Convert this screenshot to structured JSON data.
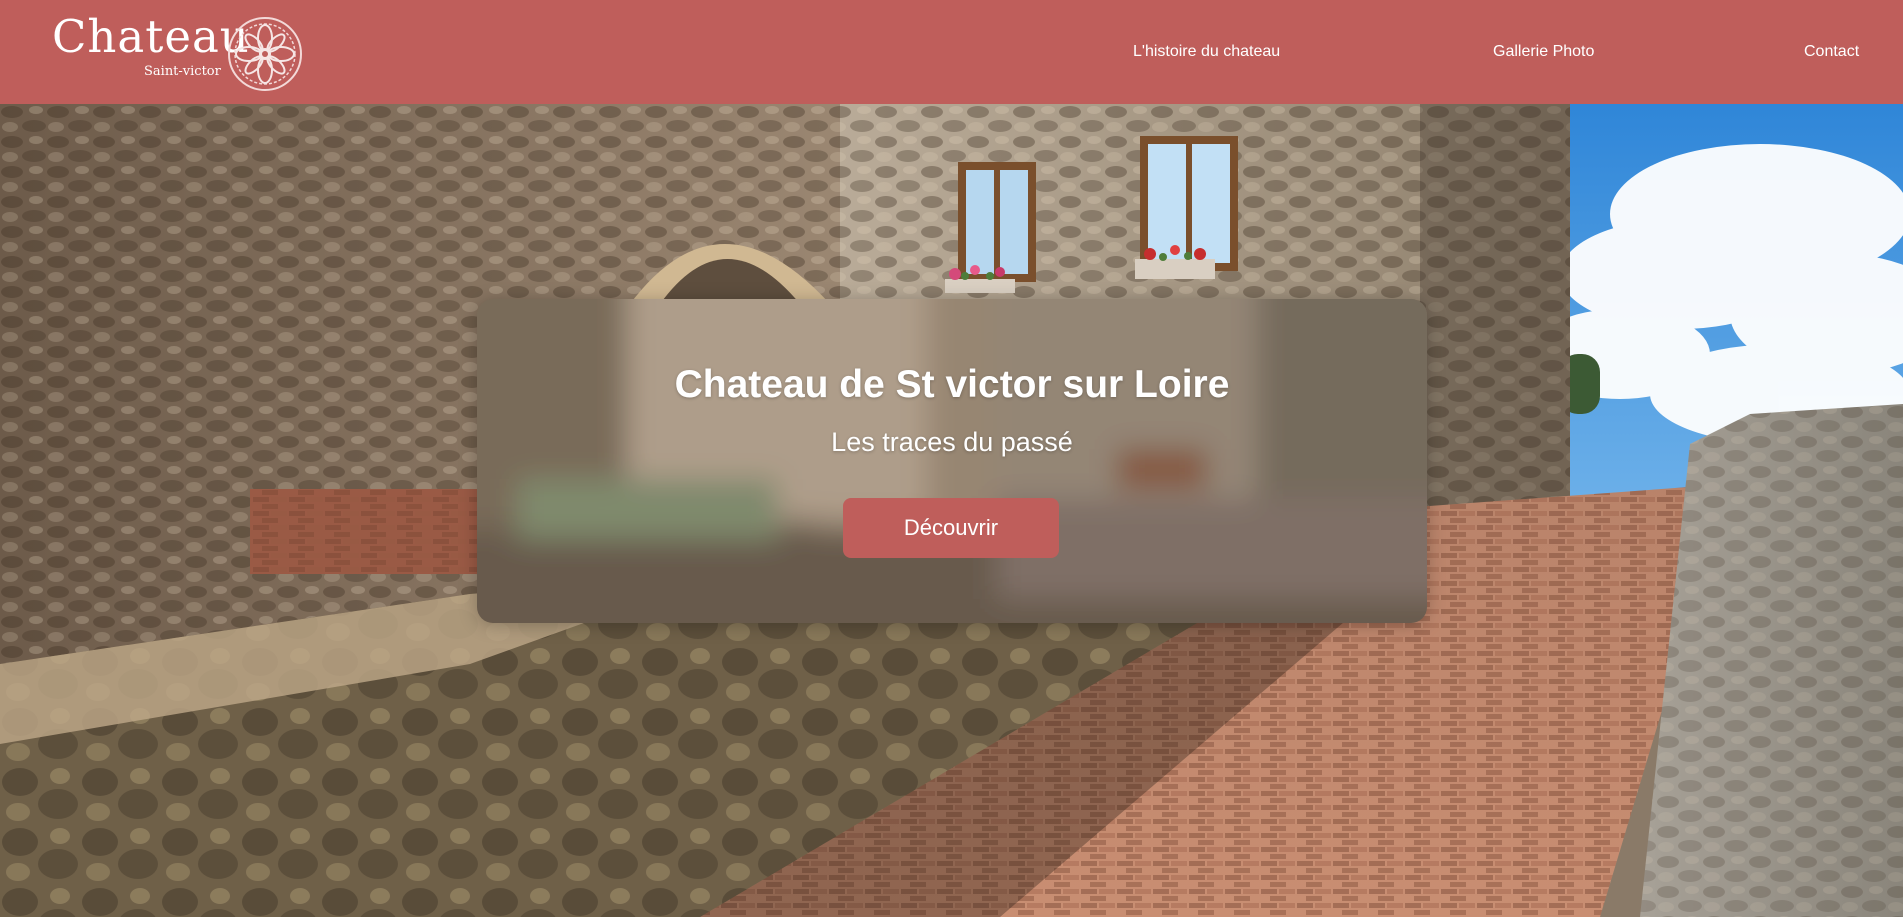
{
  "brand": {
    "name": "Chateau",
    "subtitle": "Saint-victor",
    "emblem_icon": "rosette-emblem-icon"
  },
  "nav": {
    "items": [
      {
        "label": "L'histoire du chateau"
      },
      {
        "label": "Gallerie Photo"
      },
      {
        "label": "Contact"
      }
    ]
  },
  "hero": {
    "title": "Chateau de St victor sur Loire",
    "subtitle": "Les traces du passé",
    "cta_label": "Découvrir"
  },
  "colors": {
    "header_bg": "#bf5e5b",
    "button_bg": "#bf5e5b",
    "text": "#ffffff"
  }
}
